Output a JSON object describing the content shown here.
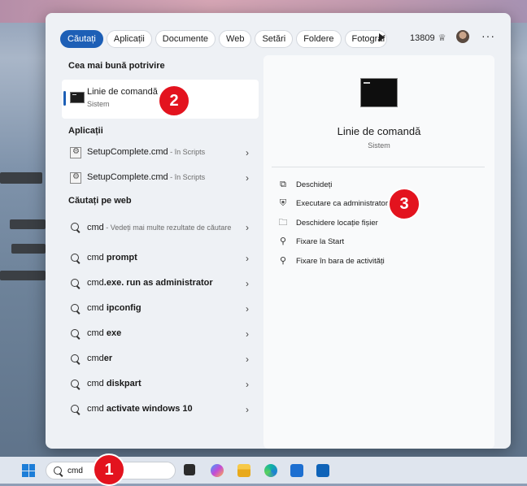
{
  "filters": {
    "tabs": [
      {
        "label": "Căutați",
        "active": true
      },
      {
        "label": "Aplicații"
      },
      {
        "label": "Documente"
      },
      {
        "label": "Web"
      },
      {
        "label": "Setări"
      },
      {
        "label": "Foldere"
      },
      {
        "label": "Fotograf"
      }
    ],
    "points": "13809"
  },
  "best_match": {
    "heading": "Cea mai bună potrivire",
    "title": "Linie de comandă",
    "subtitle": "Sistem"
  },
  "apps": {
    "heading": "Aplicații",
    "items": [
      {
        "name": "SetupComplete.cmd",
        "sub": " - în Scripts"
      },
      {
        "name": "SetupComplete.cmd",
        "sub": " - în Scripts"
      }
    ]
  },
  "web": {
    "heading": "Căutați pe web",
    "first": {
      "name": "cmd",
      "sub": " - Vedeți mai multe rezultate de căutare"
    },
    "items": [
      {
        "plain": "cmd ",
        "bold": "prompt"
      },
      {
        "plain": "cmd",
        "bold": ".exe. run as administrator"
      },
      {
        "plain": "cmd ",
        "bold": "ipconfig"
      },
      {
        "plain": "cmd ",
        "bold": "exe"
      },
      {
        "plain": "cmd",
        "bold": "er"
      },
      {
        "plain": "cmd ",
        "bold": "diskpart"
      },
      {
        "plain": "cmd ",
        "bold": "activate windows 10"
      }
    ]
  },
  "details": {
    "title": "Linie de comandă",
    "subtitle": "Sistem",
    "actions": [
      {
        "label": "Deschideți",
        "icon": "open-external-icon"
      },
      {
        "label": "Executare ca administrator",
        "icon": "shield-icon"
      },
      {
        "label": "Deschidere locație fișier",
        "icon": "folder-icon"
      },
      {
        "label": "Fixare la Start",
        "icon": "pin-icon"
      },
      {
        "label": "Fixare în bara de activități",
        "icon": "pin-icon"
      }
    ]
  },
  "badges": [
    "1",
    "2",
    "3"
  ],
  "taskbar": {
    "search_value": "cmd"
  },
  "colors": {
    "accent": "#1d5fb6",
    "badge": "#e3131e"
  }
}
